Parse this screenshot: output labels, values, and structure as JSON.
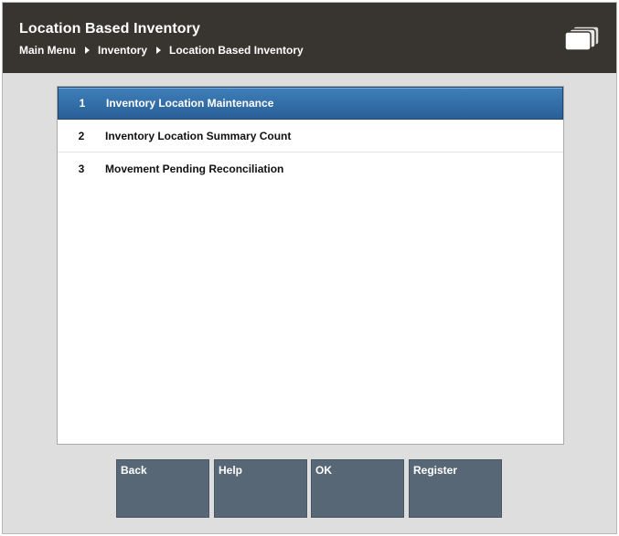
{
  "header": {
    "title": "Location Based Inventory",
    "breadcrumb": [
      "Main Menu",
      "Inventory",
      "Location Based Inventory"
    ],
    "icon": "windows-icon"
  },
  "menu": {
    "items": [
      {
        "number": "1",
        "label": "Inventory Location Maintenance",
        "selected": true
      },
      {
        "number": "2",
        "label": "Inventory Location Summary Count",
        "selected": false
      },
      {
        "number": "3",
        "label": "Movement Pending Reconciliation",
        "selected": false
      }
    ]
  },
  "buttons": {
    "back": "Back",
    "help": "Help",
    "ok": "OK",
    "register": "Register"
  },
  "colors": {
    "header_bg": "#38342f",
    "selection": "#2f6aa6",
    "button_bg": "#586776",
    "background": "#dedede"
  }
}
